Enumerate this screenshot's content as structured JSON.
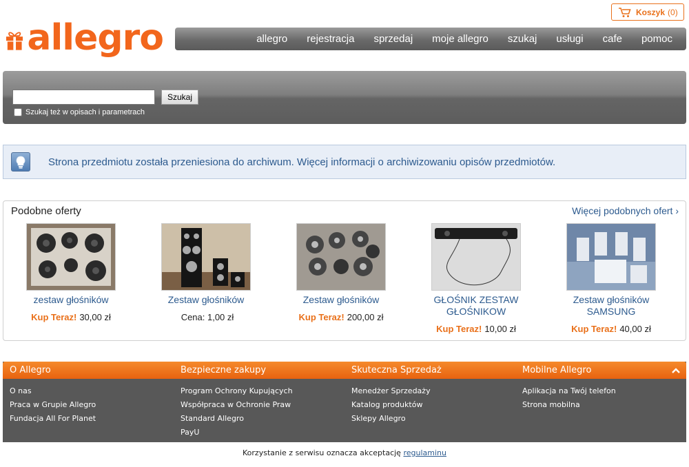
{
  "cart": {
    "label": "Koszyk",
    "count": "(0)"
  },
  "logo": {
    "text": "allegro"
  },
  "nav": [
    "allegro",
    "rejestracja",
    "sprzedaj",
    "moje allegro",
    "szukaj",
    "usługi",
    "cafe",
    "pomoc"
  ],
  "search": {
    "value": "",
    "button": "Szukaj",
    "checkbox_label": "Szukaj też w opisach i parametrach"
  },
  "info": {
    "text_before": "Strona przedmiotu została przeniesiona do archiwum. ",
    "link": "Więcej informacji",
    "text_after": " o archiwizowaniu opisów przedmiotów."
  },
  "similar": {
    "title": "Podobne oferty",
    "more": "Więcej podobnych ofert ›",
    "items": [
      {
        "name": "zestaw głośników",
        "buy": "Kup Teraz!",
        "price": "30,00 zł"
      },
      {
        "name": "Zestaw głośników",
        "buy": "",
        "price": "Cena: 1,00 zł"
      },
      {
        "name": "Zestaw głośników",
        "buy": "Kup Teraz!",
        "price": "200,00 zł"
      },
      {
        "name": "GŁOŚNIK ZESTAW GŁOŚNIKOW",
        "buy": "Kup Teraz!",
        "price": "10,00 zł"
      },
      {
        "name": "Zestaw głośników SAMSUNG",
        "buy": "Kup Teraz!",
        "price": "40,00 zł"
      }
    ]
  },
  "footer": {
    "columns": [
      {
        "title": "O Allegro",
        "links": [
          "O nas",
          "Praca w Grupie Allegro",
          "Fundacja All For Planet"
        ]
      },
      {
        "title": "Bezpieczne zakupy",
        "links": [
          "Program Ochrony Kupujących",
          "Współpraca w Ochronie Praw",
          "Standard Allegro",
          "PayU"
        ]
      },
      {
        "title": "Skuteczna Sprzedaż",
        "links": [
          "Menedżer Sprzedaży",
          "Katalog produktów",
          "Sklepy Allegro"
        ]
      },
      {
        "title": "Mobilne Allegro",
        "links": [
          "Aplikacja na Twój telefon",
          "Strona mobilna"
        ]
      }
    ]
  },
  "terms": {
    "text": "Korzystanie z serwisu oznacza akceptację ",
    "link": "regulaminu"
  },
  "colors": {
    "accent": "#f2661c",
    "link": "#2c5a8e",
    "footer": "#585858"
  }
}
